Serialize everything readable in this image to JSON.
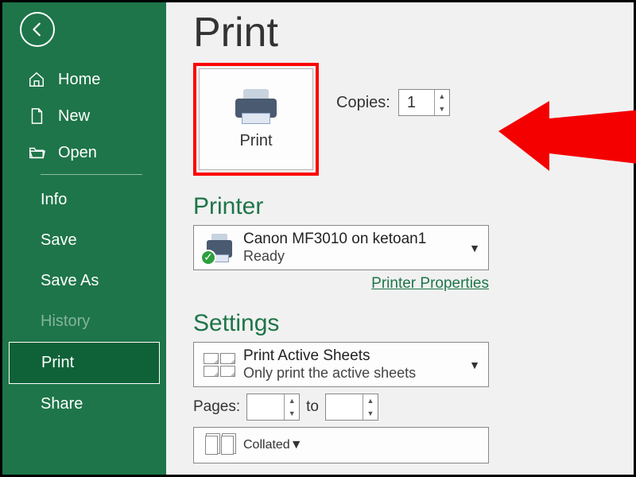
{
  "sidebar": {
    "items": [
      {
        "label": "Home",
        "icon": "home"
      },
      {
        "label": "New",
        "icon": "file"
      },
      {
        "label": "Open",
        "icon": "folder"
      }
    ],
    "sub": [
      {
        "label": "Info"
      },
      {
        "label": "Save"
      },
      {
        "label": "Save As"
      },
      {
        "label": "History",
        "dim": true
      },
      {
        "label": "Print",
        "active": true
      },
      {
        "label": "Share"
      }
    ]
  },
  "main": {
    "title": "Print",
    "print_button_label": "Print",
    "copies_label": "Copies:",
    "copies_value": "1",
    "printer_heading": "Printer",
    "printer_name": "Canon MF3010 on ketoan1",
    "printer_status": "Ready",
    "printer_props_link": "Printer Properties",
    "settings_heading": "Settings",
    "print_what_line1": "Print Active Sheets",
    "print_what_line2": "Only print the active sheets",
    "pages_label": "Pages:",
    "pages_to": "to",
    "pages_from": "",
    "pages_to_val": "",
    "collated_line1": "Collated"
  }
}
